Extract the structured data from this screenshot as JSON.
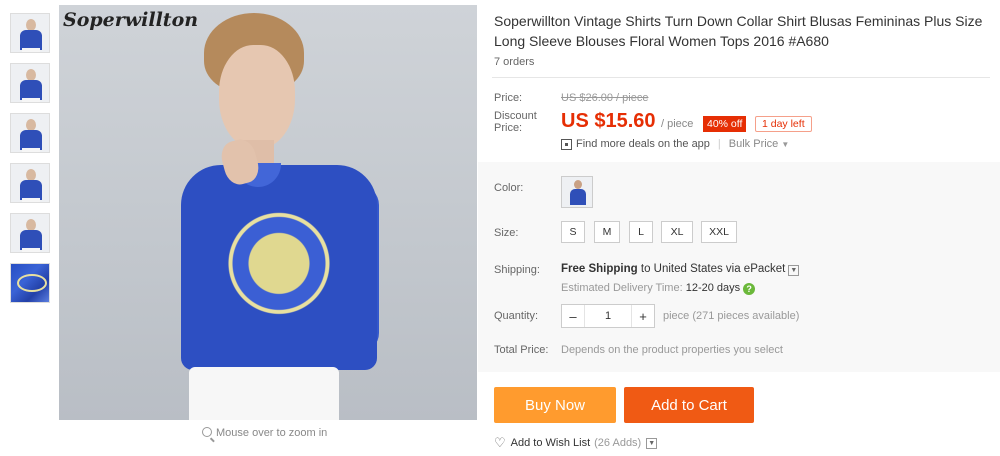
{
  "gallery": {
    "brand_watermark": "Soperwillton",
    "zoom_hint": "Mouse over to zoom in",
    "thumbnail_count": 6
  },
  "product": {
    "title": "Soperwillton Vintage Shirts Turn Down Collar Shirt Blusas Femininas Plus Size Long Sleeve Blouses Floral Women Tops 2016 #A680",
    "orders": "7 orders"
  },
  "pricing": {
    "price_label": "Price:",
    "original_price": "US $26.00 / piece",
    "discount_label": "Discount Price:",
    "discount_price": "US $15.60",
    "per_unit": "/ piece",
    "discount_badge": "40% off",
    "time_badge": "1 day left",
    "app_deals": "Find more deals on the app",
    "bulk_price": "Bulk Price"
  },
  "options": {
    "color_label": "Color:",
    "size_label": "Size:",
    "sizes": [
      "S",
      "M",
      "L",
      "XL",
      "XXL"
    ]
  },
  "shipping": {
    "label": "Shipping:",
    "free_text": "Free Shipping",
    "to_text": "to",
    "destination": "United States via ePacket",
    "delivery_label": "Estimated Delivery Time:",
    "delivery_days": "12-20 days"
  },
  "quantity": {
    "label": "Quantity:",
    "value": "1",
    "minus": "–",
    "plus": "+",
    "availability": "piece (271 pieces available)"
  },
  "total": {
    "label": "Total Price:",
    "note": "Depends on the product properties you select"
  },
  "actions": {
    "buy_now": "Buy Now",
    "add_to_cart": "Add to Cart",
    "wishlist": "Add to Wish List",
    "wishlist_count": "(26 Adds)"
  },
  "colors": {
    "accent_red": "#e62e04",
    "buy_orange": "#ff9b2e",
    "cart_orange": "#f05a14"
  }
}
